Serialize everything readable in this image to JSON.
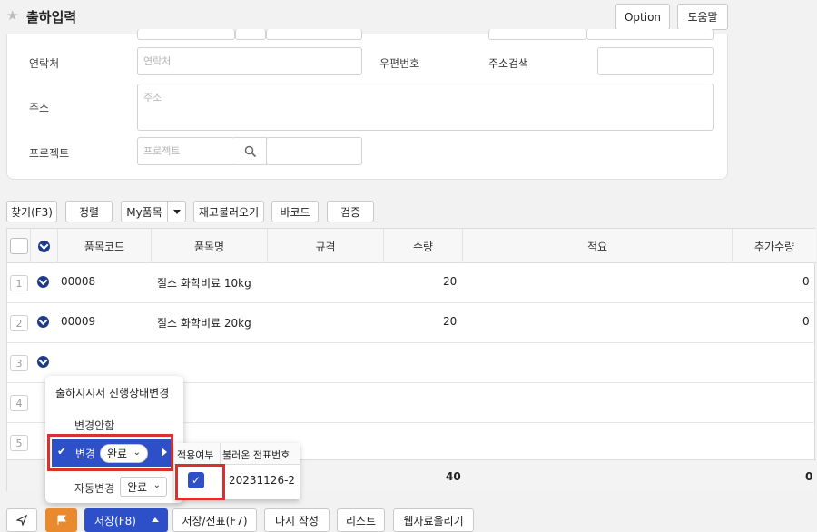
{
  "header": {
    "title": "출하입력",
    "option_label": "Option",
    "help_label": "도움말"
  },
  "form": {
    "contact_label": "연락처",
    "contact_placeholder": "연락처",
    "postal_label": "우편번호",
    "address_search_label": "주소검색",
    "address_label": "주소",
    "address_placeholder": "주소",
    "project_label": "프로젝트",
    "project_placeholder": "프로젝트"
  },
  "toolbar": {
    "find": "찾기(F3)",
    "sort": "정렬",
    "my_items": "My품목",
    "reload_stock": "재고불러오기",
    "barcode": "바코드",
    "verify": "검증"
  },
  "grid": {
    "columns": [
      "품목코드",
      "품목명",
      "규격",
      "수량",
      "적요",
      "추가수량"
    ],
    "rows": [
      {
        "num": "1",
        "code": "00008",
        "name": "질소 화학비료 10kg",
        "spec": "",
        "qty": "20",
        "memo": "",
        "extra": "0"
      },
      {
        "num": "2",
        "code": "00009",
        "name": "질소 화학비료 20kg",
        "spec": "",
        "qty": "20",
        "memo": "",
        "extra": "0"
      },
      {
        "num": "3"
      },
      {
        "num": "4"
      },
      {
        "num": "5"
      }
    ],
    "total_qty": "40",
    "total_extra": "0"
  },
  "popup": {
    "title": "출하지시서 진행상태변경",
    "no_change": "변경안함",
    "change": "변경",
    "change_value": "완료",
    "auto_change": "자동변경",
    "auto_value": "완료",
    "sub_col1": "적용여부",
    "sub_col2": "불러온 전표번호",
    "sub_value": "20231126-2"
  },
  "bottom": {
    "save": "저장(F8)",
    "save_slip": "저장/전표(F7)",
    "rewrite": "다시 작성",
    "list": "리스트",
    "web_upload": "웹자료올리기"
  },
  "colors": {
    "accent": "#2d4fc8",
    "highlight": "#d8312f",
    "flag": "#e98a2e",
    "icon_navy": "#1e3a8a"
  }
}
